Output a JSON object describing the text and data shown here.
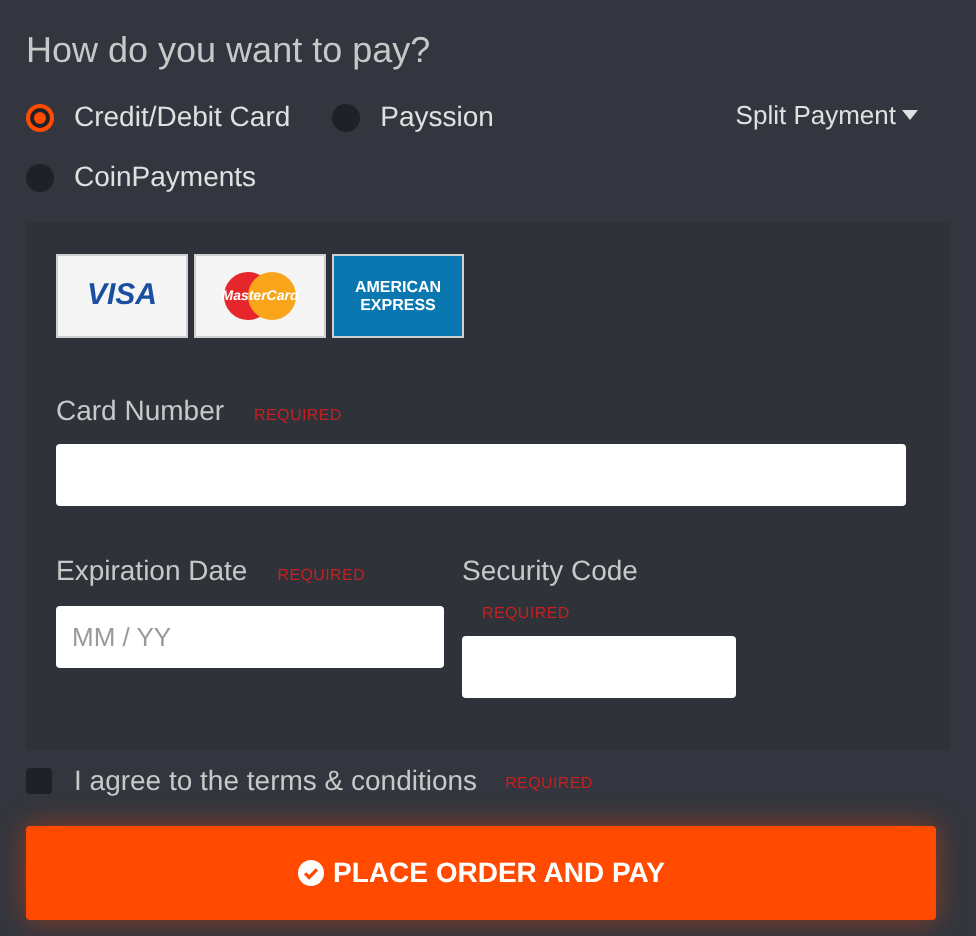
{
  "title": "How do you want to pay?",
  "payment_methods": [
    {
      "label": "Credit/Debit Card",
      "selected": true
    },
    {
      "label": "Payssion",
      "selected": false
    },
    {
      "label": "CoinPayments",
      "selected": false
    }
  ],
  "split_payment": {
    "label": "Split Payment"
  },
  "card_logos": [
    {
      "kind": "visa",
      "text": "VISA"
    },
    {
      "kind": "mastercard",
      "text": "MasterCard"
    },
    {
      "kind": "amex",
      "text": "AMERICAN EXPRESS"
    }
  ],
  "fields": {
    "card_number": {
      "label": "Card Number",
      "required": "REQUIRED"
    },
    "expiration": {
      "label": "Expiration Date",
      "required": "REQUIRED",
      "placeholder": "MM / YY"
    },
    "security": {
      "label": "Security Code",
      "required": "REQUIRED"
    }
  },
  "terms": {
    "label": "I agree to the terms & conditions",
    "required": "REQUIRED",
    "checked": false
  },
  "submit": {
    "label": "PLACE ORDER AND PAY"
  }
}
